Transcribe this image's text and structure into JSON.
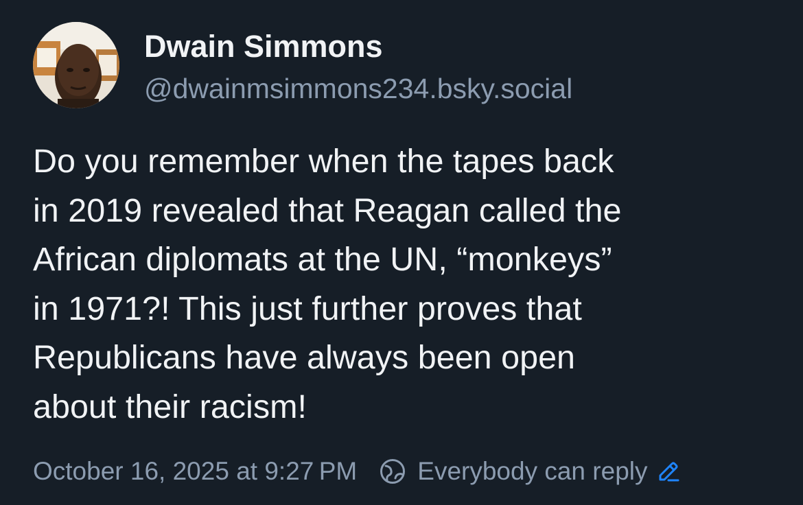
{
  "author": {
    "display_name": "Dwain Simmons",
    "handle": "@dwainmsimmons234.bsky.social",
    "avatar_icon": "profile-photo"
  },
  "post": {
    "text_lines": [
      "Do you remember when the tapes back",
      "in 2019 revealed that Reagan called the",
      "African diplomats at the UN, “monkeys”",
      "in 1971?! This just further proves that",
      "Republicans have always been open",
      "about their racism!"
    ]
  },
  "meta": {
    "timestamp": "October 16, 2025 at 9:27 PM",
    "reply_setting": "Everybody can reply",
    "globe_icon": "globe-icon",
    "edit_icon": "pencil-icon"
  },
  "colors": {
    "background": "#161e27",
    "text": "#f1f3f5",
    "muted": "#8c9cb0",
    "accent": "#1f85ff"
  }
}
